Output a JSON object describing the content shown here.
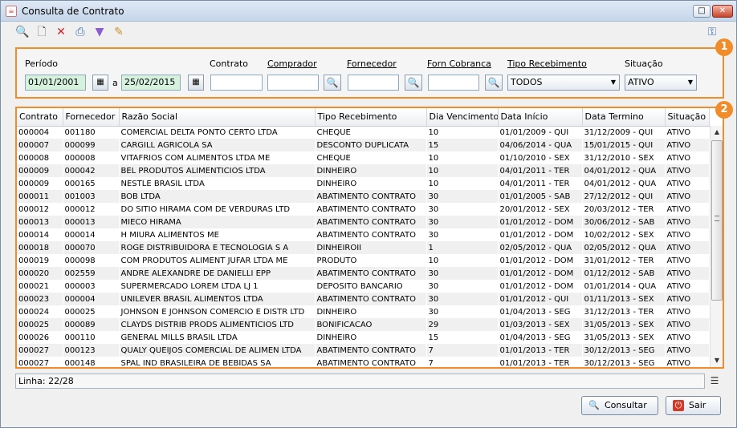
{
  "window": {
    "title": "Consulta de Contrato"
  },
  "toolbar": {
    "icons": [
      "search-icon",
      "new-document-icon",
      "delete-icon",
      "print-icon",
      "filter-icon",
      "edit-icon",
      "key-icon"
    ]
  },
  "badges": {
    "search_panel": "1",
    "table_panel": "2"
  },
  "filters": {
    "periodo_label": "Período",
    "periodo_from": "01/01/2001",
    "periodo_sep": "a",
    "periodo_to": "25/02/2015",
    "contrato_label": "Contrato",
    "contrato_value": "",
    "comprador_label": "Comprador",
    "comprador_value": "",
    "fornecedor_label": "Fornecedor",
    "fornecedor_value": "",
    "forn_cobranca_label": "Forn Cobranca",
    "forn_cobranca_value": "",
    "tipo_recebimento_label": "Tipo Recebimento",
    "tipo_recebimento_value": "TODOS",
    "situacao_label": "Situação",
    "situacao_value": "ATIVO"
  },
  "table": {
    "columns": [
      "Contrato",
      "Fornecedor",
      "Razão Social",
      "Tipo Recebimento",
      "Dia Vencimento",
      "Data Início",
      "Data Termino",
      "Situação"
    ],
    "rows": [
      [
        "000004",
        "001180",
        "COMERCIAL DELTA PONTO CERTO LTDA",
        "CHEQUE",
        "10",
        "01/01/2009 - QUI",
        "31/12/2009 - QUI",
        "ATIVO"
      ],
      [
        "000007",
        "000099",
        "CARGILL AGRICOLA SA",
        "DESCONTO DUPLICATA",
        "15",
        "04/06/2014 - QUA",
        "15/01/2015 - QUI",
        "ATIVO"
      ],
      [
        "000008",
        "000008",
        "VITAFRIOS COM ALIMENTOS LTDA ME",
        "CHEQUE",
        "10",
        "01/10/2010 - SEX",
        "31/12/2010 - SEX",
        "ATIVO"
      ],
      [
        "000009",
        "000042",
        "BEL PRODUTOS ALIMENTICIOS LTDA",
        "DINHEIRO",
        "10",
        "04/01/2011 - TER",
        "04/01/2012 - QUA",
        "ATIVO"
      ],
      [
        "000009",
        "000165",
        "NESTLE BRASIL LTDA",
        "DINHEIRO",
        "10",
        "04/01/2011 - TER",
        "04/01/2012 - QUA",
        "ATIVO"
      ],
      [
        "000011",
        "001003",
        "BOB LTDA",
        "ABATIMENTO CONTRATO",
        "30",
        "01/01/2005 - SAB",
        "27/12/2012 - QUI",
        "ATIVO"
      ],
      [
        "000012",
        "000012",
        "DO SITIO HIRAMA COM DE VERDURAS LTD",
        "ABATIMENTO CONTRATO",
        "30",
        "20/01/2012 - SEX",
        "20/03/2012 - TER",
        "ATIVO"
      ],
      [
        "000013",
        "000013",
        "MIECO HIRAMA",
        "ABATIMENTO CONTRATO",
        "30",
        "01/01/2012 - DOM",
        "30/06/2012 - SAB",
        "ATIVO"
      ],
      [
        "000014",
        "000014",
        "H MIURA ALIMENTOS ME",
        "ABATIMENTO CONTRATO",
        "30",
        "01/01/2012 - DOM",
        "10/02/2012 - SEX",
        "ATIVO"
      ],
      [
        "000018",
        "000070",
        "ROGE DISTRIBUIDORA E TECNOLOGIA S A",
        "DINHEIROII",
        "1",
        "02/05/2012 - QUA",
        "02/05/2012 - QUA",
        "ATIVO"
      ],
      [
        "000019",
        "000098",
        "COM PRODUTOS ALIMENT JUFAR LTDA ME",
        "PRODUTO",
        "10",
        "01/01/2012 - DOM",
        "31/01/2012 - TER",
        "ATIVO"
      ],
      [
        "000020",
        "002559",
        "ANDRE ALEXANDRE DE DANIELLI EPP",
        "ABATIMENTO CONTRATO",
        "30",
        "01/01/2012 - DOM",
        "01/12/2012 - SAB",
        "ATIVO"
      ],
      [
        "000021",
        "000003",
        "SUPERMERCADO LOREM LTDA LJ 1",
        "DEPOSITO BANCARIO",
        "30",
        "01/01/2012 - DOM",
        "01/01/2014 - QUA",
        "ATIVO"
      ],
      [
        "000023",
        "000004",
        "UNILEVER BRASIL ALIMENTOS LTDA",
        "ABATIMENTO CONTRATO",
        "30",
        "01/01/2012 - QUI",
        "01/11/2013 - SEX",
        "ATIVO"
      ],
      [
        "000024",
        "000025",
        "JOHNSON E JOHNSON COMERCIO E DISTR LTD",
        "DINHEIRO",
        "30",
        "01/04/2013 - SEG",
        "31/12/2013 - TER",
        "ATIVO"
      ],
      [
        "000025",
        "000089",
        "CLAYDS DISTRIB PRODS ALIMENTICIOS LTD",
        "BONIFICACAO",
        "29",
        "01/03/2013 - SEX",
        "31/05/2013 - SEX",
        "ATIVO"
      ],
      [
        "000026",
        "000110",
        "GENERAL MILLS BRASIL LTDA",
        "DINHEIRO",
        "15",
        "01/04/2013 - SEG",
        "31/05/2013 - SEX",
        "ATIVO"
      ],
      [
        "000027",
        "000123",
        "QUALY QUEIJOS COMERCIAL DE ALIMEN LTDA",
        "ABATIMENTO CONTRATO",
        "7",
        "01/01/2013 - TER",
        "30/12/2013 - SEG",
        "ATIVO"
      ],
      [
        "000027",
        "000148",
        "SPAL IND BRASILEIRA DE BEBIDAS SA",
        "ABATIMENTO CONTRATO",
        "7",
        "01/01/2013 - TER",
        "30/12/2013 - SEG",
        "ATIVO"
      ]
    ]
  },
  "status": {
    "linha": "Linha: 22/28"
  },
  "buttons": {
    "consultar": "Consultar",
    "sair": "Sair"
  },
  "colors": {
    "highlight": "#f08c2a",
    "date_field": "#d6f1dd"
  }
}
